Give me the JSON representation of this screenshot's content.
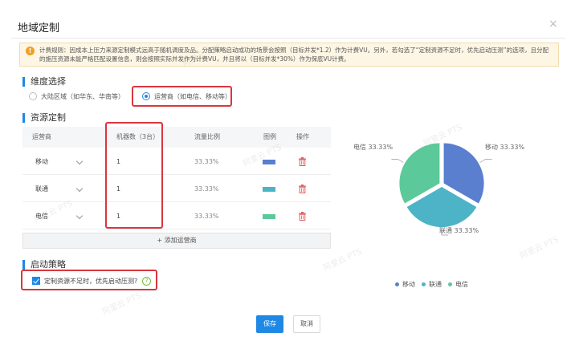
{
  "dialog": {
    "title": "地域定制",
    "close_glyph": "×"
  },
  "notice": {
    "icon_glyph": "!",
    "text": "计费规则：因成本上压力来源定制模式远高于随机调度及品。分配策略启动成功的场景会按照（目标并发*1.2）作为计费VU。另外，若勾选了“定制资源不足时，优先启动压测”的选项，且分配的施压资源未能严格匹配设置信息，则会按照实际并发作为计费VU，并且将以（目标并发*30%）作为保底VU计费。"
  },
  "dimension": {
    "heading": "维度选择",
    "options": [
      {
        "label": "大陆区域（如华东、华南等）",
        "selected": false
      },
      {
        "label": "运营商（如电信、移动等）",
        "selected": true
      }
    ]
  },
  "resources": {
    "heading": "资源定制",
    "columns": [
      "运营商",
      "机器数（3台）",
      "流量比例",
      "图例",
      "操作"
    ],
    "rows": [
      {
        "carrier": "移动",
        "machines": "1",
        "ratio": "33.33%",
        "color": "#5b7fcf"
      },
      {
        "carrier": "联通",
        "machines": "1",
        "ratio": "33.33%",
        "color": "#4db3c6"
      },
      {
        "carrier": "电信",
        "machines": "1",
        "ratio": "33.33%",
        "color": "#5cc99a"
      }
    ],
    "add_label": "+ 添加运营商"
  },
  "strategy": {
    "heading": "启动策略",
    "checkbox_label": "定制资源不足时，优先启动压测?",
    "checked": true,
    "help_glyph": "?"
  },
  "chart_data": {
    "type": "pie",
    "categories": [
      "移动",
      "联通",
      "电信"
    ],
    "values": [
      33.33,
      33.33,
      33.33
    ],
    "labels": [
      "移动 33.33%",
      "联通 33.33%",
      "电信 33.33%"
    ],
    "colors": [
      "#5b7fcf",
      "#4db3c6",
      "#5cc99a"
    ],
    "legend_position": "bottom"
  },
  "buttons": {
    "save": "保存",
    "cancel": "取消"
  },
  "watermark": {
    "text": "阿里云 PTS"
  }
}
